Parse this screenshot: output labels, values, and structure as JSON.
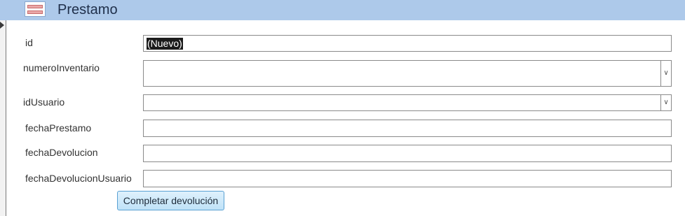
{
  "form": {
    "title": "Prestamo"
  },
  "fields": {
    "id": {
      "label": "id",
      "value": "(Nuevo)"
    },
    "numero_inventario": {
      "label": "numeroInventario",
      "value": ""
    },
    "id_usuario": {
      "label": "idUsuario",
      "value": ""
    },
    "fecha_prestamo": {
      "label": "fechaPrestamo",
      "value": ""
    },
    "fecha_devolucion": {
      "label": "fechaDevolucion",
      "value": ""
    },
    "fecha_devolucion_usuario": {
      "label": "fechaDevolucionUsuario",
      "value": ""
    }
  },
  "buttons": {
    "completar": "Completar devolución"
  },
  "icons": {
    "form": "form-icon",
    "record_selector": "record-selector-arrow-icon",
    "dropdown": "chevron-down-icon"
  },
  "colors": {
    "header": "#adc9ea",
    "button_border": "#5aa1d3"
  }
}
